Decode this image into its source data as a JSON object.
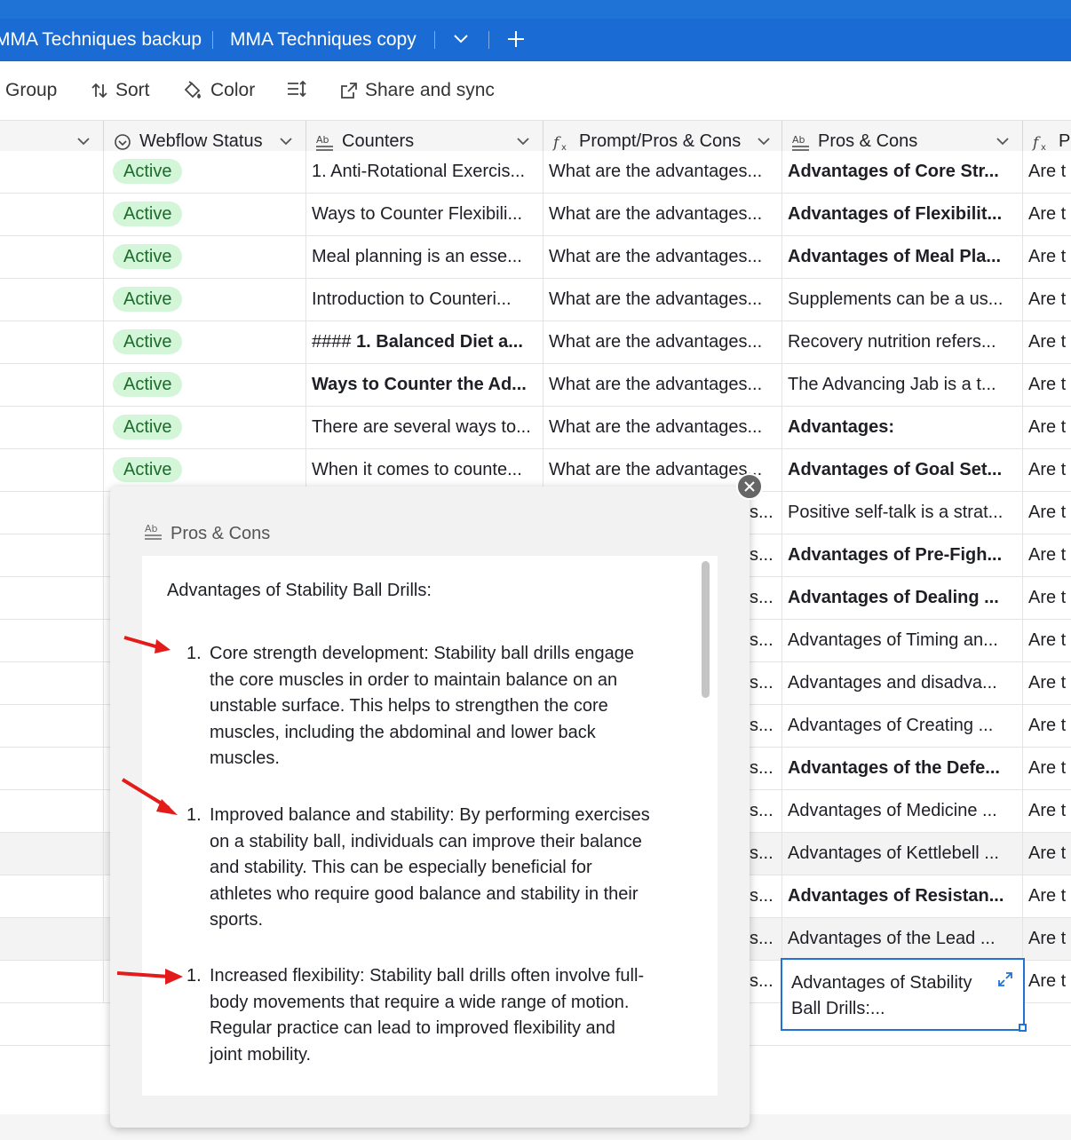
{
  "tabs": [
    "MMA Techniques backup",
    "MMA Techniques copy"
  ],
  "toolbar": {
    "group": "Group",
    "sort": "Sort",
    "color": "Color",
    "share": "Share and sync"
  },
  "columns": {
    "webflow": "Webflow Status",
    "counters": "Counters",
    "prompt": "Prompt/Pros & Cons",
    "pros": "Pros & Cons",
    "last": "Pr"
  },
  "status_active": "Active",
  "rows": [
    {
      "status": "Active",
      "counters": "1. Anti-Rotational Exercis...",
      "counters_bold": false,
      "prompt": "What are the advantages...",
      "pros": "Advantages of Core Str...",
      "pros_bold": true,
      "last": "Are t"
    },
    {
      "status": "Active",
      "counters": "Ways to Counter Flexibili...",
      "counters_bold": false,
      "prompt": "What are the advantages...",
      "pros": "Advantages of Flexibilit...",
      "pros_bold": true,
      "last": "Are t"
    },
    {
      "status": "Active",
      "counters": "Meal planning is an esse...",
      "counters_bold": false,
      "prompt": "What are the advantages...",
      "pros": "Advantages of Meal Pla...",
      "pros_bold": true,
      "last": "Are t"
    },
    {
      "status": "Active",
      "counters": "Introduction to Counteri...",
      "counters_bold": false,
      "prompt": "What are the advantages...",
      "pros": "Supplements can be a us...",
      "pros_bold": false,
      "last": "Are t"
    },
    {
      "status": "Active",
      "counters_prefix": "#### ",
      "counters": "1. Balanced Diet a...",
      "counters_bold": "partial",
      "prompt": "What are the advantages...",
      "pros": "Recovery nutrition refers...",
      "pros_bold": false,
      "last": "Are t"
    },
    {
      "status": "Active",
      "counters": "Ways to Counter the Ad...",
      "counters_bold": true,
      "prompt": "What are the advantages...",
      "pros": "The Advancing Jab is a t...",
      "pros_bold": false,
      "last": "Are t"
    },
    {
      "status": "Active",
      "counters": "There are several ways to...",
      "counters_bold": false,
      "prompt": "What are the advantages...",
      "pros": "Advantages:",
      "pros_bold": true,
      "last": "Are t"
    },
    {
      "status": "Active",
      "counters": "When it comes to counte...",
      "counters_bold": false,
      "prompt": "What are the advantages...",
      "pros": "Advantages of Goal Set...",
      "pros_bold": true,
      "last": "Are t"
    },
    {
      "prompt_tail": "s...",
      "pros": "Positive self-talk is a strat...",
      "pros_bold": false,
      "last": "Are t"
    },
    {
      "prompt_tail": "s...",
      "pros": "Advantages of Pre-Figh...",
      "pros_bold": true,
      "last": "Are t"
    },
    {
      "prompt_tail": "s...",
      "pros": "Advantages of Dealing ...",
      "pros_bold": true,
      "last": "Are t"
    },
    {
      "prompt_tail": "s...",
      "pros": "Advantages of Timing an...",
      "pros_bold": false,
      "last": "Are t"
    },
    {
      "prompt_tail": "s...",
      "pros": "Advantages and disadva...",
      "pros_bold": false,
      "last": "Are t"
    },
    {
      "prompt_tail": "s...",
      "pros": "Advantages of Creating ...",
      "pros_bold": false,
      "last": "Are t"
    },
    {
      "prompt_tail": "s...",
      "pros": "Advantages of the Defe...",
      "pros_bold": true,
      "last": "Are t"
    },
    {
      "prompt_tail": "s...",
      "pros": "Advantages of Medicine ...",
      "pros_bold": false,
      "last": "Are t"
    },
    {
      "prompt_tail": "s...",
      "pros": "Advantages of Kettlebell ...",
      "pros_bold": false,
      "last": "Are t"
    },
    {
      "prompt_tail": "s...",
      "pros": "Advantages of Resistan...",
      "pros_bold": true,
      "last": "Are t"
    },
    {
      "prompt_tail": "s...",
      "pros": "Advantages of the Lead ...",
      "pros_bold": false,
      "last": "Are t"
    },
    {
      "prompt_tail": "s...",
      "pros": "",
      "pros_bold": false,
      "last": "Are t"
    }
  ],
  "selected_cell": {
    "line1": "Advantages of Stability",
    "line2": "Ball Drills:..."
  },
  "popup": {
    "title": "Pros & Cons",
    "intro": "Advantages of Stability Ball Drills:",
    "items": [
      {
        "num": "1.",
        "lines": [
          "Core strength development: Stability ball drills engage",
          "the core muscles in order to maintain balance on an",
          "unstable surface. This helps to strengthen the core",
          "muscles, including the abdominal and lower back",
          "muscles."
        ]
      },
      {
        "num": "1.",
        "lines": [
          "Improved balance and stability: By performing exercises",
          "on a stability ball, individuals can improve their balance",
          "and stability. This can be especially beneficial for",
          "athletes who require good balance and stability in their",
          "sports."
        ]
      },
      {
        "num": "1.",
        "lines": [
          "Increased flexibility: Stability ball drills often involve full-",
          "body movements that require a wide range of motion.",
          "Regular practice can lead to improved flexibility and",
          "joint mobility."
        ]
      }
    ]
  },
  "colors": {
    "accent": "#1f72d6",
    "pill_bg": "#d3f5d8",
    "pill_text": "#1d6b2c",
    "arrow": "#e31b1b"
  }
}
